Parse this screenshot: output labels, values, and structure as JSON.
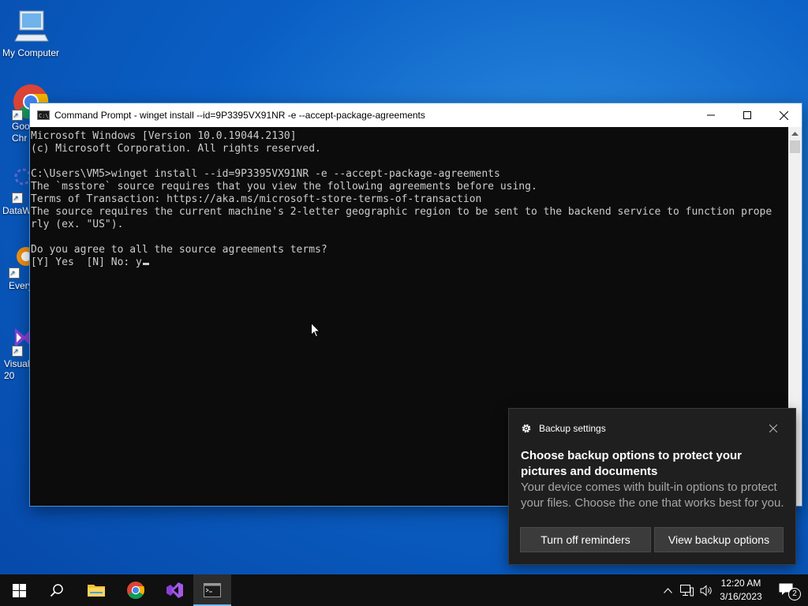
{
  "desktop": {
    "icons": [
      {
        "label": "My Computer"
      },
      {
        "label": "Goo Chr"
      },
      {
        "label": "DataW"
      },
      {
        "label": "Every"
      },
      {
        "label": "Visual 20"
      }
    ]
  },
  "console_window": {
    "title": "Command Prompt - winget  install --id=9P3395VX91NR -e --accept-package-agreements",
    "lines": [
      "Microsoft Windows [Version 10.0.19044.2130]",
      "(c) Microsoft Corporation. All rights reserved.",
      "",
      "C:\\Users\\VM5>winget install --id=9P3395VX91NR -e --accept-package-agreements",
      "The `msstore` source requires that you view the following agreements before using.",
      "Terms of Transaction: https://aka.ms/microsoft-store-terms-of-transaction",
      "The source requires the current machine's 2-letter geographic region to be sent to the backend service to function prope",
      "rly (ex. \"US\").",
      "",
      "Do you agree to all the source agreements terms?",
      "[Y] Yes  [N] No: y"
    ]
  },
  "toast": {
    "app": "Backup settings",
    "title": "Choose backup options to protect your pictures and documents",
    "body": "Your device comes with built-in options to protect your files. Choose the one that works best for you.",
    "buttons": {
      "dismiss": "Turn off reminders",
      "primary": "View backup options"
    }
  },
  "taskbar": {
    "time": "12:20 AM",
    "date": "3/16/2023",
    "notification_count": "2",
    "accent_color": "#76b9ed"
  }
}
